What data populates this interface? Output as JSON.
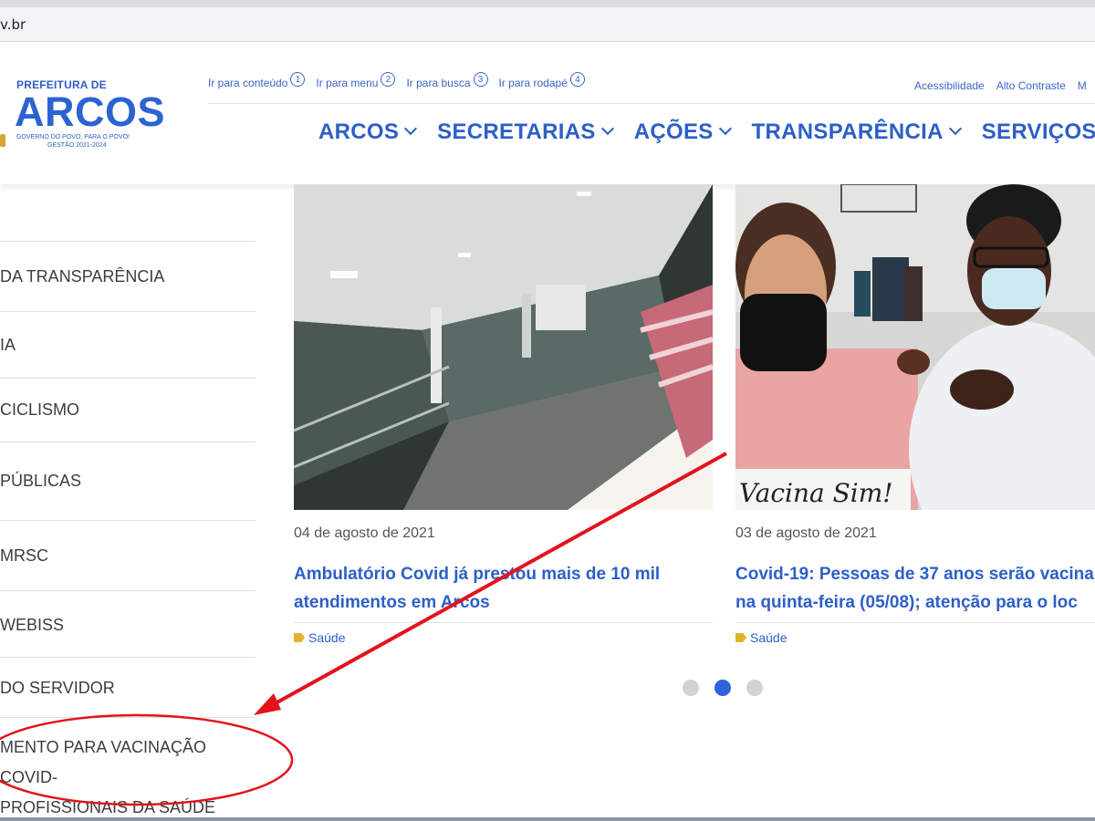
{
  "browser": {
    "url_fragment": "v.br"
  },
  "logo": {
    "prefix": "PREFEITURA DE",
    "name": "ARCOS",
    "tagline": "GOVERNO DO POVO, PARA O POVO!",
    "term": "GESTÃO 2021-2024"
  },
  "skip_links": [
    {
      "label": "Ir para conteúdo",
      "num": "1"
    },
    {
      "label": "Ir para menu",
      "num": "2"
    },
    {
      "label": "Ir para busca",
      "num": "3"
    },
    {
      "label": "Ir para rodapé",
      "num": "4"
    }
  ],
  "accessibility": {
    "acc": "Acessibilidade",
    "contrast": "Alto Contraste",
    "more": "M"
  },
  "nav": [
    {
      "label": "ARCOS"
    },
    {
      "label": "SECRETARIAS"
    },
    {
      "label": "AÇÕES"
    },
    {
      "label": "TRANSPARÊNCIA"
    },
    {
      "label": "SERVIÇOS"
    }
  ],
  "sidebar": {
    "items": [
      "DA TRANSPARÊNCIA",
      "IA",
      "CICLISMO",
      "PÚBLICAS",
      "MRSC",
      "WEBISS",
      "DO SERVIDOR"
    ],
    "highlighted_line1": "MENTO PARA VACINAÇÃO COVID-",
    "highlighted_line2": "PROFISSIONAIS DA SAÚDE"
  },
  "news": [
    {
      "date": "04 de agosto de 2021",
      "title_line1": "Ambulatório Covid já prestou mais de 10 mil",
      "title_line2": "atendimentos em Arcos",
      "tag": "Saúde"
    },
    {
      "date": "03 de agosto de 2021",
      "title_line1": "Covid-19: Pessoas de 37 anos serão vacina",
      "title_line2": "na quinta-feira (05/08); atenção para o loc",
      "tag": "Saúde",
      "photo_sign": "Vacina Sim!"
    }
  ],
  "carousel": {
    "total_dots": 3,
    "active_index": 1
  },
  "colors": {
    "brand_blue": "#2d5fc7",
    "annotation_red": "#e3131b",
    "tag_yellow": "#e2b22b",
    "dot_active": "#2f63d9"
  }
}
